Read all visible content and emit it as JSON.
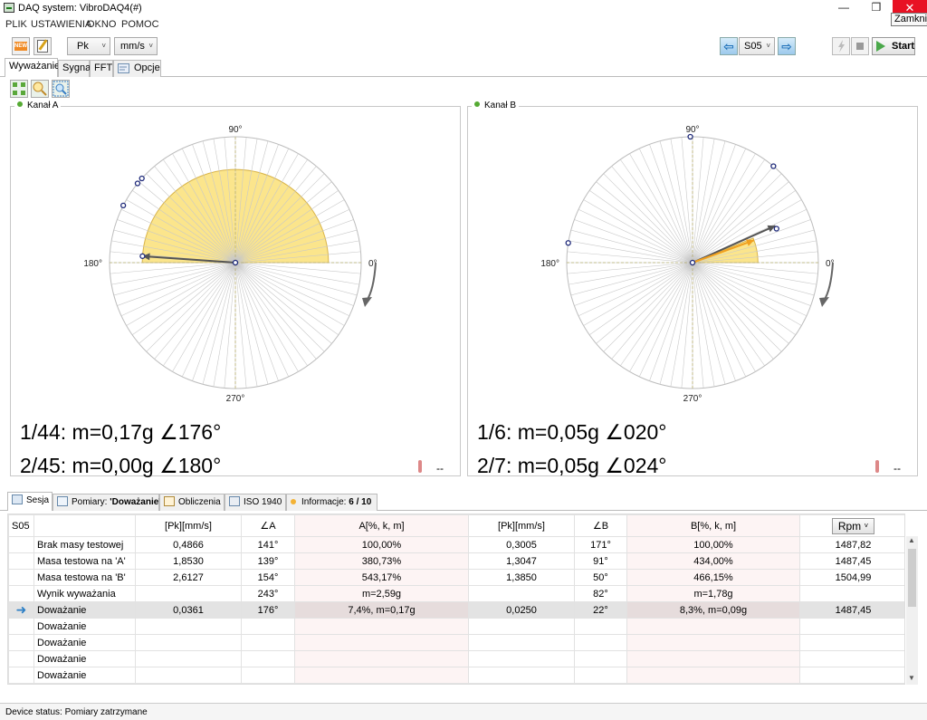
{
  "window": {
    "title": "DAQ system:  VibroDAQ4(#)",
    "close_tooltip": "Zamknij",
    "min_glyph": "—",
    "max_glyph": "❒",
    "close_glyph": "✕"
  },
  "menu": [
    "PLIK",
    "USTAWIENIA",
    "OKNO",
    "POMOC"
  ],
  "toolbar": {
    "new_icon_text": "NEW",
    "mode": "Pk",
    "unit": "mm/s",
    "session": "S05",
    "start_label": "Start",
    "arrow_left": "⇦",
    "arrow_right": "⇨",
    "combo_arrow": "˅"
  },
  "tabs": [
    "Wyważanie",
    "Sygnał",
    "FFT",
    "Opcje"
  ],
  "channels": [
    {
      "label": "Kanał A",
      "axis_labels": {
        "top": "90°",
        "bottom": "270°",
        "left": "180°",
        "right": "0°"
      },
      "sector_start_deg": 0,
      "sector_end_deg": 180,
      "sector_radius_frac": 0.74,
      "vector_angle_deg": 176,
      "vector_len_frac": 0.74,
      "points": [
        {
          "angle_deg": 176,
          "r": 0.74
        },
        {
          "angle_deg": 138,
          "r": 1.0
        },
        {
          "angle_deg": 141,
          "r": 1.0
        },
        {
          "angle_deg": 153,
          "r": 1.0
        }
      ],
      "result_lines": [
        "1/44:  m=0,17g ∠176°",
        "2/45:  m=0,00g ∠180°"
      ],
      "temp_value": "--"
    },
    {
      "label": "Kanał B",
      "axis_labels": {
        "top": "90°",
        "bottom": "270°",
        "left": "180°",
        "right": "0°"
      },
      "sector_start_deg": 0,
      "sector_end_deg": 22,
      "sector_radius_frac": 0.52,
      "vector_angle_deg": 20,
      "vector_len_frac": 0.52,
      "second_vector_angle_deg": 24,
      "second_vector_len_frac": 0.72,
      "points": [
        {
          "angle_deg": 22,
          "r": 0.72
        },
        {
          "angle_deg": 50,
          "r": 1.0
        },
        {
          "angle_deg": 91,
          "r": 1.0
        },
        {
          "angle_deg": 171,
          "r": 1.0
        }
      ],
      "result_lines": [
        "1/6:  m=0,05g ∠020°",
        "2/7:  m=0,05g ∠024°"
      ],
      "temp_value": "--"
    }
  ],
  "bottom_tabs": {
    "session": "Sesja",
    "measurements_prefix": "Pomiary: ",
    "measurements_name": "'Doważanie'",
    "calculations": "Obliczenia",
    "iso": "ISO 1940",
    "info_prefix": "Informacje: ",
    "info_count": "6 / 10"
  },
  "table": {
    "headers": [
      "S05",
      "",
      "[Pk][mm/s]",
      "∠A",
      "A[%, k, m]",
      "[Pk][mm/s]",
      "∠B",
      "B[%, k, m]",
      "Rpm"
    ],
    "rpm_arrow": "˅",
    "selected_arrow": "➜",
    "rows": [
      {
        "marker": "",
        "name": "Brak masy testowej",
        "pkA": "0,4866",
        "angA": "141°",
        "A": "100,00%",
        "pkB": "0,3005",
        "angB": "171°",
        "B": "100,00%",
        "rpm": "1487,82",
        "selected": false
      },
      {
        "marker": "",
        "name": "Masa testowa na 'A'",
        "pkA": "1,8530",
        "angA": "139°",
        "A": "380,73%",
        "pkB": "1,3047",
        "angB": "91°",
        "B": "434,00%",
        "rpm": "1487,45",
        "selected": false
      },
      {
        "marker": "",
        "name": "Masa testowa na 'B'",
        "pkA": "2,6127",
        "angA": "154°",
        "A": "543,17%",
        "pkB": "1,3850",
        "angB": "50°",
        "B": "466,15%",
        "rpm": "1504,99",
        "selected": false
      },
      {
        "marker": "",
        "name": "Wynik wyważania",
        "pkA": "",
        "angA": "243°",
        "A": "m=2,59g",
        "pkB": "",
        "angB": "82°",
        "B": "m=1,78g",
        "rpm": "",
        "selected": false
      },
      {
        "marker": "arrow",
        "name": "Doważanie",
        "pkA": "0,0361",
        "angA": "176°",
        "A": "7,4%, m=0,17g",
        "pkB": "0,0250",
        "angB": "22°",
        "B": "8,3%, m=0,09g",
        "rpm": "1487,45",
        "selected": true
      },
      {
        "marker": "",
        "name": "Doważanie",
        "pkA": "",
        "angA": "",
        "A": "",
        "pkB": "",
        "angB": "",
        "B": "",
        "rpm": "",
        "selected": false
      },
      {
        "marker": "",
        "name": "Doważanie",
        "pkA": "",
        "angA": "",
        "A": "",
        "pkB": "",
        "angB": "",
        "B": "",
        "rpm": "",
        "selected": false
      },
      {
        "marker": "",
        "name": "Doważanie",
        "pkA": "",
        "angA": "",
        "A": "",
        "pkB": "",
        "angB": "",
        "B": "",
        "rpm": "",
        "selected": false
      },
      {
        "marker": "",
        "name": "Doważanie",
        "pkA": "",
        "angA": "",
        "A": "",
        "pkB": "",
        "angB": "",
        "B": "",
        "rpm": "",
        "selected": false
      }
    ]
  },
  "status": "Device status: Pomiary zatrzymane",
  "colors": {
    "sector_fill": "#fbe58c",
    "sector_stroke": "#d9b44a",
    "vector": "#555555",
    "vector_b2": "#f0a020",
    "point": "#1f2a7a",
    "spoke": "#c8c8c8"
  }
}
